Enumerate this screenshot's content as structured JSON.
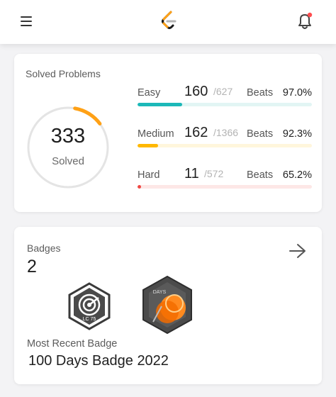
{
  "header": {
    "menu_icon": "hamburger-menu-icon",
    "logo_icon": "leetcode-logo-icon",
    "notification_icon": "bell-icon",
    "notification_dot_color": "#ff4d4f"
  },
  "solved": {
    "title": "Solved Problems",
    "total": "333",
    "total_label": "Solved",
    "ring_progress": 0.12,
    "rows": [
      {
        "difficulty": "Easy",
        "count": "160",
        "total": "/627",
        "beats_label": "Beats",
        "percent": "97.0%",
        "fraction": 0.255,
        "color": "#1cb8b8",
        "track_color": "#e2f5f4"
      },
      {
        "difficulty": "Medium",
        "count": "162",
        "total": "/1366",
        "beats_label": "Beats",
        "percent": "92.3%",
        "fraction": 0.119,
        "color": "#ffb800",
        "track_color": "#fff6dc"
      },
      {
        "difficulty": "Hard",
        "count": "11",
        "total": "/572",
        "beats_label": "Beats",
        "percent": "65.2%",
        "fraction": 0.019,
        "color": "#ef4743",
        "track_color": "#fde7e6"
      }
    ]
  },
  "badges": {
    "title": "Badges",
    "count": "2",
    "arrow_icon": "arrow-right-icon",
    "items": [
      {
        "icon": "lc75-badge-icon",
        "label": "LC 75"
      },
      {
        "icon": "100-days-badge-icon",
        "label": "DAYS"
      }
    ],
    "recent_label": "Most Recent Badge",
    "recent_name": "100 Days Badge 2022"
  }
}
